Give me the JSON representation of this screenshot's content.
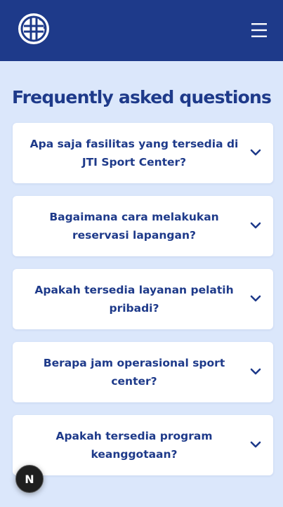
{
  "header": {
    "logo_icon": "sport-ball-icon",
    "menu_icon": "hamburger-menu-icon",
    "background_color": "#1e3a8a"
  },
  "faq": {
    "title": "Frequently asked questions",
    "items": [
      {
        "question": "Apa saja fasilitas yang tersedia di JTI Sport Center?"
      },
      {
        "question": "Bagaimana cara melakukan reservasi lapangan?"
      },
      {
        "question": "Apakah tersedia layanan pelatih pribadi?"
      },
      {
        "question": "Berapa jam operasional sport center?"
      },
      {
        "question": "Apakah tersedia program keanggotaan?"
      }
    ],
    "chevron_icon": "chevron-down-icon"
  },
  "fab": {
    "label": "N",
    "icon": "nextjs-badge-icon"
  },
  "colors": {
    "primary": "#1e3a8a",
    "page_background": "#dbe7fb",
    "card_background": "#ffffff"
  }
}
